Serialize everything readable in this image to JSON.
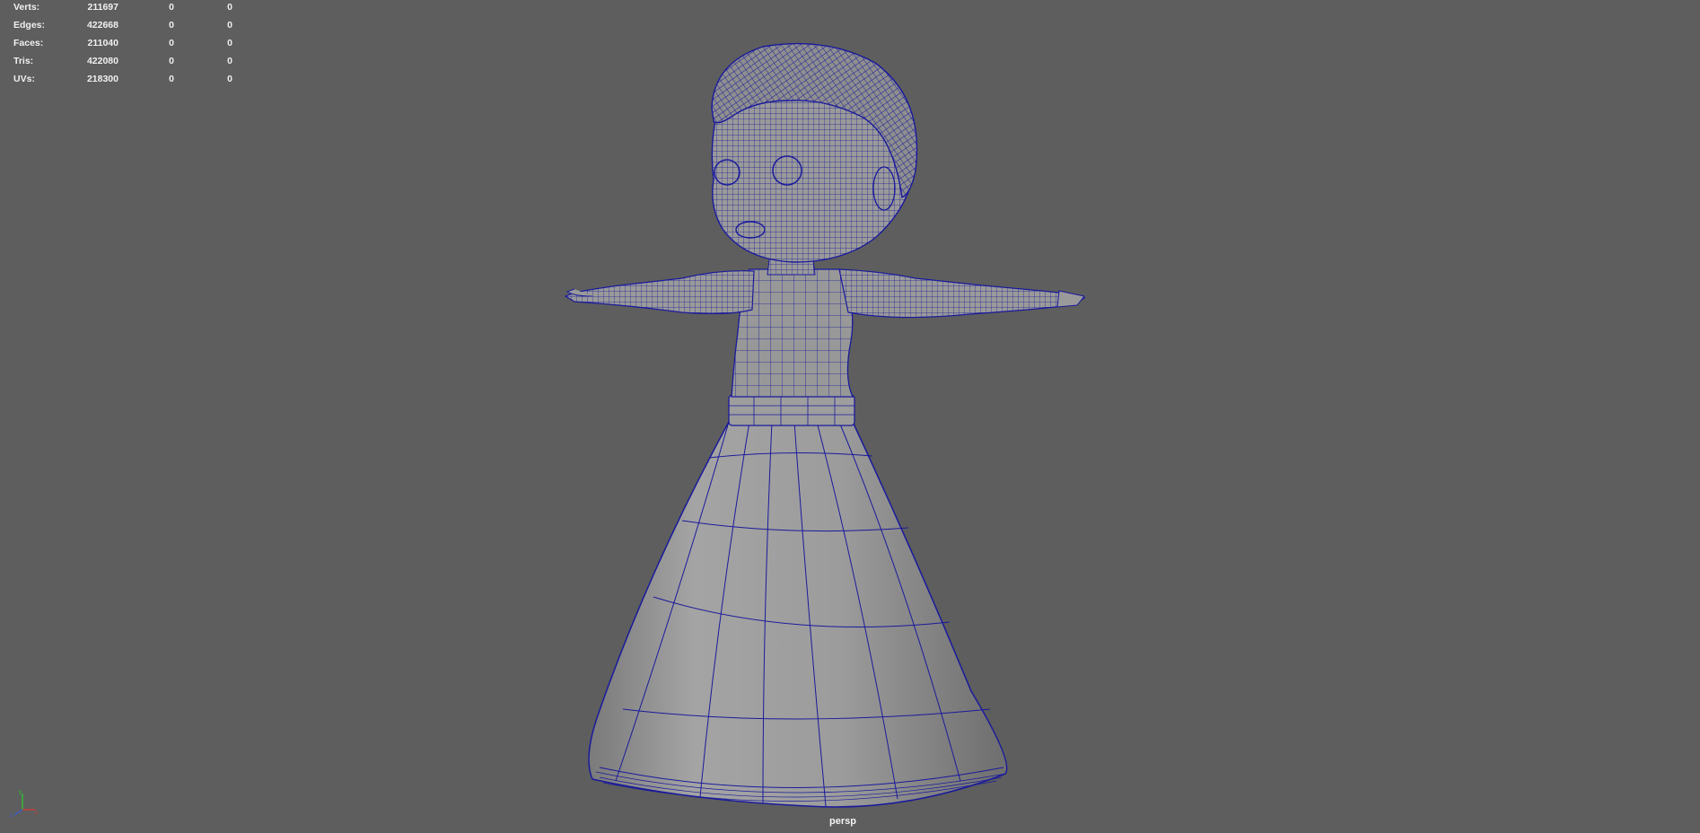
{
  "viewport": {
    "camera": "persp",
    "background": "#5e5e5e",
    "wire_color": "#1a1a9c",
    "mesh_color": "#9a9a9a"
  },
  "hud": {
    "rows": [
      {
        "label": "Verts:",
        "v1": "211697",
        "v2": "0",
        "v3": "0"
      },
      {
        "label": "Edges:",
        "v1": "422668",
        "v2": "0",
        "v3": "0"
      },
      {
        "label": "Faces:",
        "v1": "211040",
        "v2": "0",
        "v3": "0"
      },
      {
        "label": "Tris:",
        "v1": "422080",
        "v2": "0",
        "v3": "0"
      },
      {
        "label": "UVs:",
        "v1": "218300",
        "v2": "0",
        "v3": "0"
      }
    ]
  },
  "axis_gizmo": {
    "x": "x",
    "y": "y",
    "z": "z"
  }
}
